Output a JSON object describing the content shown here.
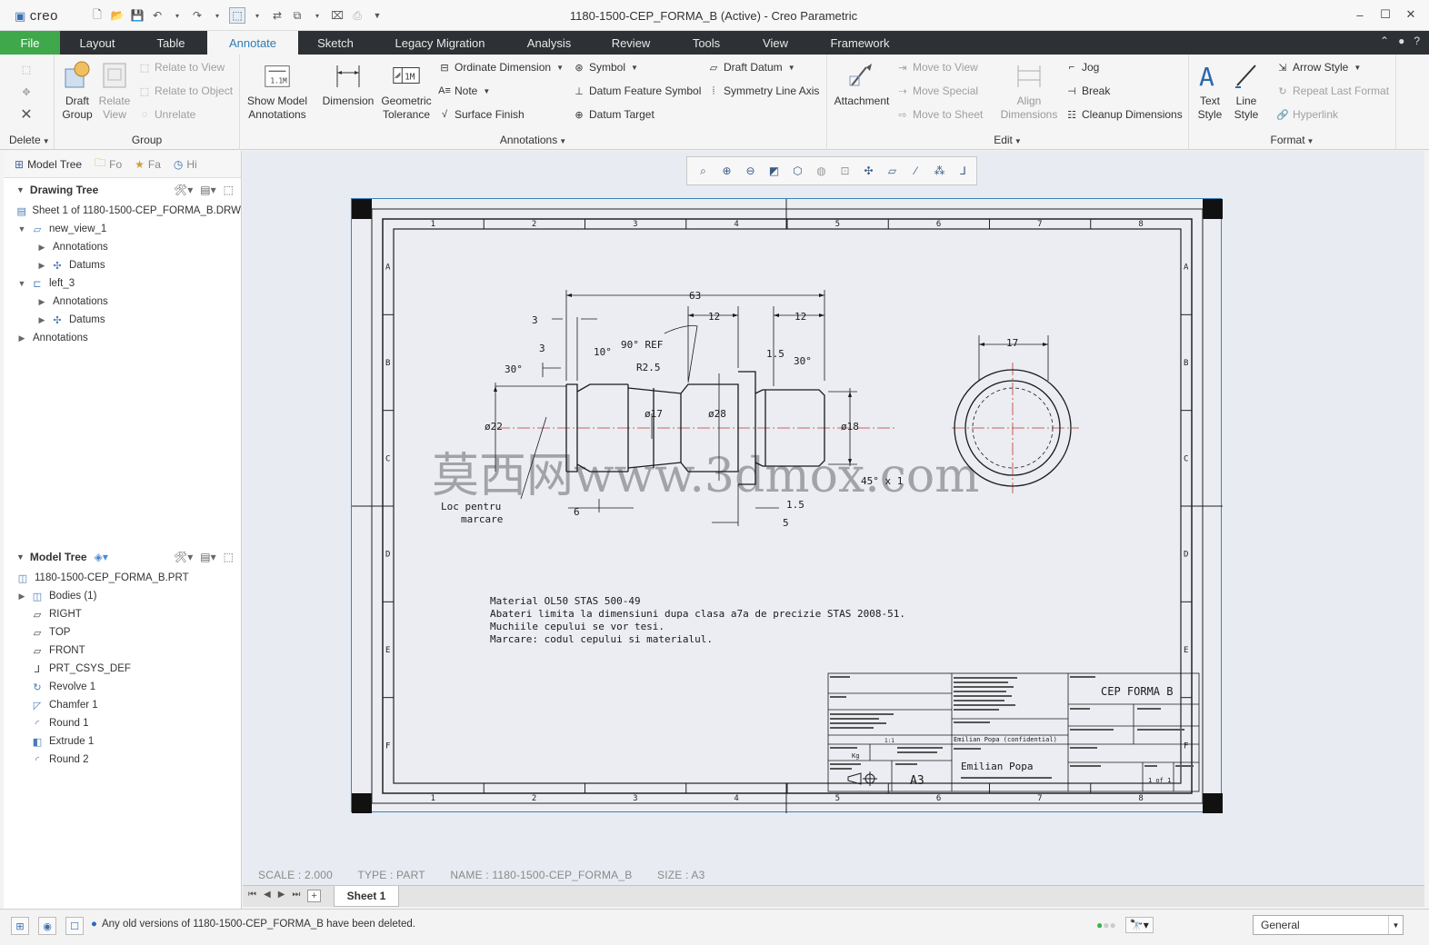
{
  "app": {
    "logo": "creo",
    "window_title": "1180-1500-CEP_FORMA_B (Active) - Creo Parametric"
  },
  "menu": {
    "file": "File",
    "tabs": [
      "Layout",
      "Table",
      "Annotate",
      "Sketch",
      "Legacy Migration",
      "Analysis",
      "Review",
      "Tools",
      "View",
      "Framework"
    ],
    "active_tab": "Annotate"
  },
  "ribbon": {
    "delete": {
      "label": "Delete"
    },
    "group": {
      "label": "Group",
      "draft_group": "Draft Group",
      "relate_view": "Relate View",
      "relate_to_view": "Relate to View",
      "relate_to_object": "Relate to Object",
      "unrelate": "Unrelate"
    },
    "show_model_annotations": "Show Model Annotations",
    "annotations": {
      "label": "Annotations",
      "dimension": "Dimension",
      "geometric_tolerance": "Geometric Tolerance",
      "ordinate_dimension": "Ordinate Dimension",
      "note": "Note",
      "surface_finish": "Surface Finish",
      "symbol": "Symbol",
      "datum_feature_symbol": "Datum Feature Symbol",
      "datum_target": "Datum Target",
      "draft_datum": "Draft Datum",
      "symmetry_line_axis": "Symmetry Line Axis"
    },
    "edit": {
      "label": "Edit",
      "attachment": "Attachment",
      "move_to_view": "Move to View",
      "move_special": "Move Special",
      "move_to_sheet": "Move to Sheet",
      "align_dimensions": "Align Dimensions",
      "jog": "Jog",
      "break": "Break",
      "cleanup_dimensions": "Cleanup Dimensions"
    },
    "format": {
      "label": "Format",
      "text_style": "Text Style",
      "line_style": "Line Style",
      "arrow_style": "Arrow Style",
      "repeat_last_format": "Repeat Last Format",
      "hyperlink": "Hyperlink"
    }
  },
  "navigator": {
    "tabs": [
      "Model Tree",
      "Fo",
      "Fa",
      "Hi"
    ],
    "drawing_tree": {
      "title": "Drawing Tree",
      "items": [
        {
          "label": "Sheet 1 of 1180-1500-CEP_FORMA_B.DRW"
        },
        {
          "label": "new_view_1"
        },
        {
          "label": "Annotations"
        },
        {
          "label": "Datums"
        },
        {
          "label": "left_3"
        },
        {
          "label": "Annotations"
        },
        {
          "label": "Datums"
        },
        {
          "label": "Annotations"
        }
      ]
    },
    "model_tree": {
      "title": "Model Tree",
      "items": [
        {
          "label": "1180-1500-CEP_FORMA_B.PRT"
        },
        {
          "label": "Bodies (1)"
        },
        {
          "label": "RIGHT"
        },
        {
          "label": "TOP"
        },
        {
          "label": "FRONT"
        },
        {
          "label": "PRT_CSYS_DEF"
        },
        {
          "label": "Revolve 1"
        },
        {
          "label": "Chamfer 1"
        },
        {
          "label": "Round 1"
        },
        {
          "label": "Extrude 1"
        },
        {
          "label": "Round 2"
        }
      ]
    }
  },
  "drawing": {
    "border_columns": [
      "1",
      "2",
      "3",
      "4",
      "5",
      "6",
      "7",
      "8"
    ],
    "border_rows": [
      "A",
      "B",
      "C",
      "D",
      "E",
      "F"
    ],
    "dims": {
      "d63": "63",
      "d3a": "3",
      "d3b": "3",
      "d12a": "12",
      "d12b": "12",
      "d10deg": "10°",
      "d90ref": "90° REF",
      "dr25": "R2.5",
      "d30a": "30°",
      "d30b": "30°",
      "d15a": "1.5",
      "d15b": "1.5",
      "d22": "ø22",
      "d17": "ø17",
      "d28": "ø28",
      "d18": "ø18",
      "d6": "6",
      "d5": "5",
      "d17top": "17",
      "chamfer": "45° x 1"
    },
    "marking_note": [
      "Loc pentru",
      "marcare"
    ],
    "notes": [
      "Material  OL50 STAS 500-49",
      "Abateri limita la dimensiuni dupa clasa a7a de precizie STAS 2008-51.",
      "Muchiile cepului se vor tesi.",
      "Marcare: codul cepului si materialul."
    ],
    "title_block": {
      "description": "CEP FORMA B",
      "name": "Emilian Popa",
      "name_confidential": "Emilian Popa (confidential)",
      "size": "A3",
      "sheet": "1 of 1",
      "scale": "1:1",
      "mass_unit": "Kg"
    },
    "watermark": "莫西网www.3dmox.com"
  },
  "graphics_info": {
    "scale": "SCALE : 2.000",
    "type": "TYPE : PART",
    "name": "NAME : 1180-1500-CEP_FORMA_B",
    "size": "SIZE : A3"
  },
  "sheet_tabs": {
    "sheet1": "Sheet 1"
  },
  "status": {
    "message": "Any old versions of 1180-1500-CEP_FORMA_B have been deleted.",
    "filter": "General"
  },
  "colors": {
    "menubar": "#2d3034",
    "file_tab": "#3fa84a",
    "active_tab_text": "#2e7db5",
    "sheet_border": "#3b84b8",
    "drawing_line": "#1a1a1a",
    "centerline": "#c0392b"
  }
}
